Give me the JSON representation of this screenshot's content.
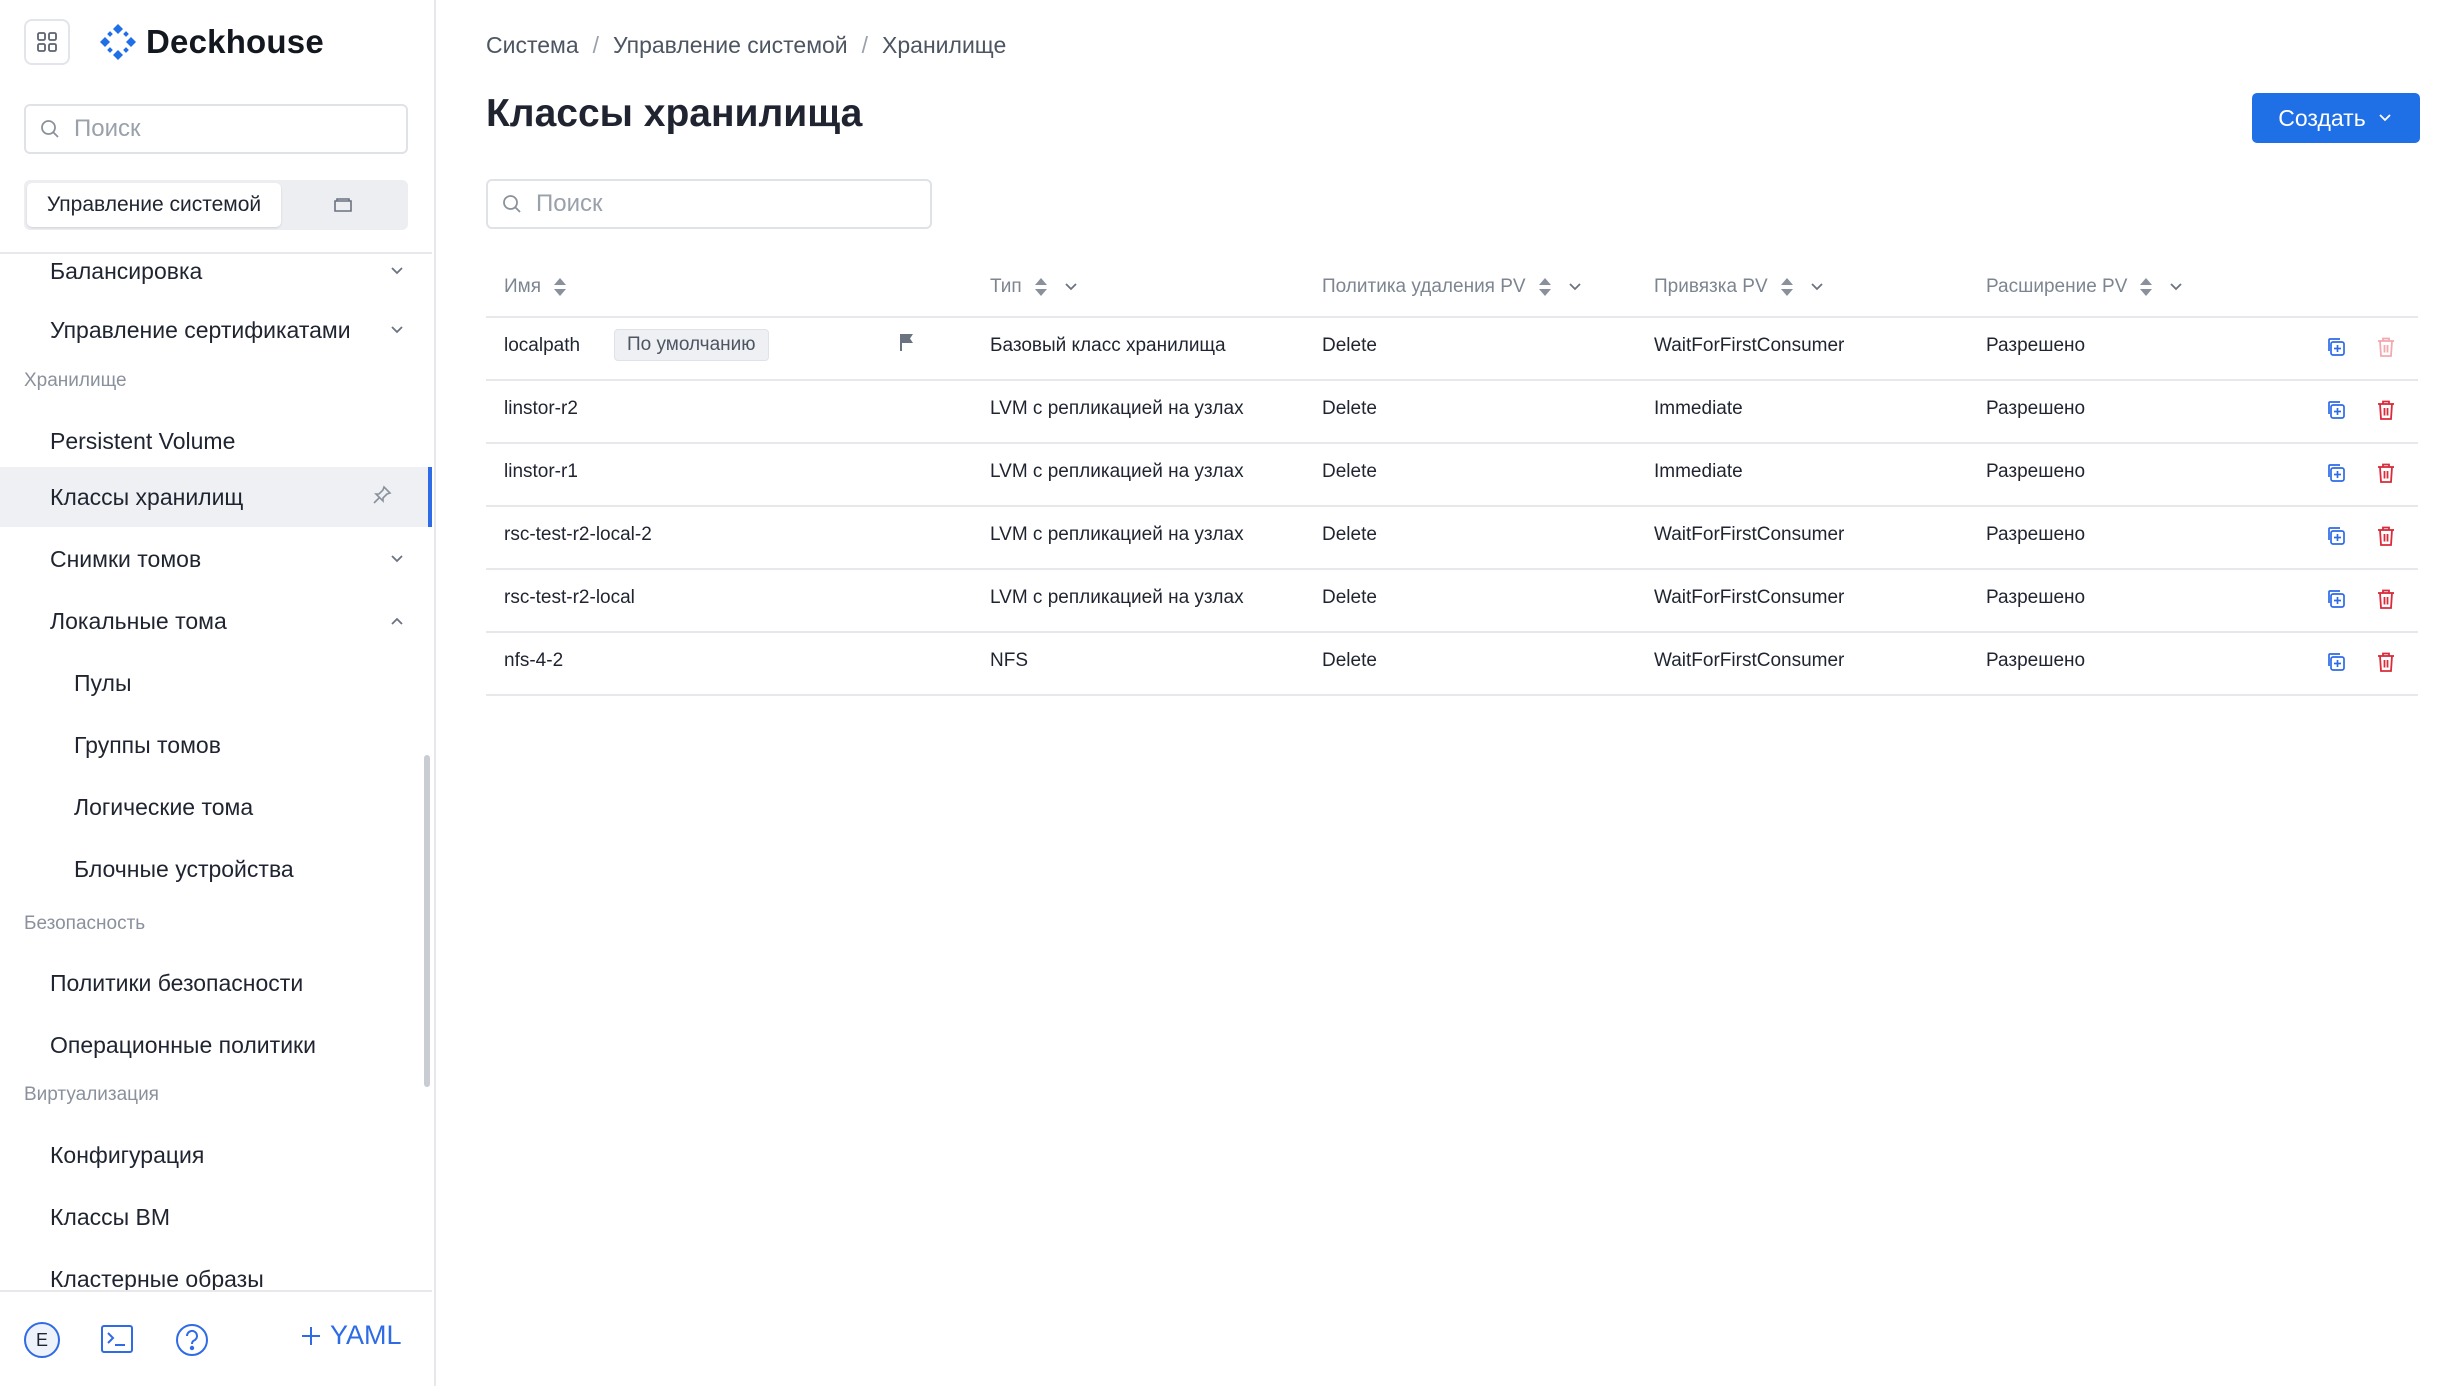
{
  "app": {
    "name": "Deckhouse"
  },
  "sidebar": {
    "search_placeholder": "Поиск",
    "segment": {
      "active": "Управление системой"
    },
    "items": [
      {
        "label": "Балансировка",
        "chevron": "down"
      },
      {
        "label": "Управление сертификатами",
        "chevron": "down"
      },
      {
        "section": "Хранилище"
      },
      {
        "label": "Persistent Volume"
      },
      {
        "label": "Классы хранилищ",
        "active": true,
        "pinned": true
      },
      {
        "label": "Снимки томов",
        "chevron": "down"
      },
      {
        "label": "Локальные тома",
        "chevron": "up"
      },
      {
        "label": "Пулы",
        "sub": true
      },
      {
        "label": "Группы томов",
        "sub": true
      },
      {
        "label": "Логические тома",
        "sub": true
      },
      {
        "label": "Блочные устройства",
        "sub": true
      },
      {
        "section": "Безопасность"
      },
      {
        "label": "Политики безопасности"
      },
      {
        "label": "Операционные политики"
      },
      {
        "section": "Виртуализация"
      },
      {
        "label": "Конфигурация"
      },
      {
        "label": "Классы ВМ"
      },
      {
        "label": "Кластерные образы"
      }
    ],
    "footer": {
      "avatar_letter": "E",
      "yaml_label": "YAML"
    }
  },
  "breadcrumb": [
    "Система",
    "Управление системой",
    "Хранилище"
  ],
  "page": {
    "title": "Классы хранилища",
    "create_label": "Создать",
    "search_placeholder": "Поиск"
  },
  "table": {
    "columns": [
      "Имя",
      "Тип",
      "Политика удаления PV",
      "Привязка PV",
      "Расширение PV"
    ],
    "rows": [
      {
        "name": "localpath",
        "badge": "По умолчанию",
        "flag": true,
        "type": "Базовый класс хранилища",
        "reclaim": "Delete",
        "binding": "WaitForFirstConsumer",
        "expansion": "Разрешено",
        "delete_disabled": true
      },
      {
        "name": "linstor-r2",
        "type": "LVM с репликацией на узлах",
        "reclaim": "Delete",
        "binding": "Immediate",
        "expansion": "Разрешено"
      },
      {
        "name": "linstor-r1",
        "type": "LVM с репликацией на узлах",
        "reclaim": "Delete",
        "binding": "Immediate",
        "expansion": "Разрешено"
      },
      {
        "name": "rsc-test-r2-local-2",
        "type": "LVM с репликацией на узлах",
        "reclaim": "Delete",
        "binding": "WaitForFirstConsumer",
        "expansion": "Разрешено"
      },
      {
        "name": "rsc-test-r2-local",
        "type": "LVM с репликацией на узлах",
        "reclaim": "Delete",
        "binding": "WaitForFirstConsumer",
        "expansion": "Разрешено"
      },
      {
        "name": "nfs-4-2",
        "type": "NFS",
        "reclaim": "Delete",
        "binding": "WaitForFirstConsumer",
        "expansion": "Разрешено"
      }
    ]
  },
  "colors": {
    "accent": "#1f6fe6",
    "danger": "#d92b3a",
    "danger_disabled": "#f2a9b0"
  }
}
